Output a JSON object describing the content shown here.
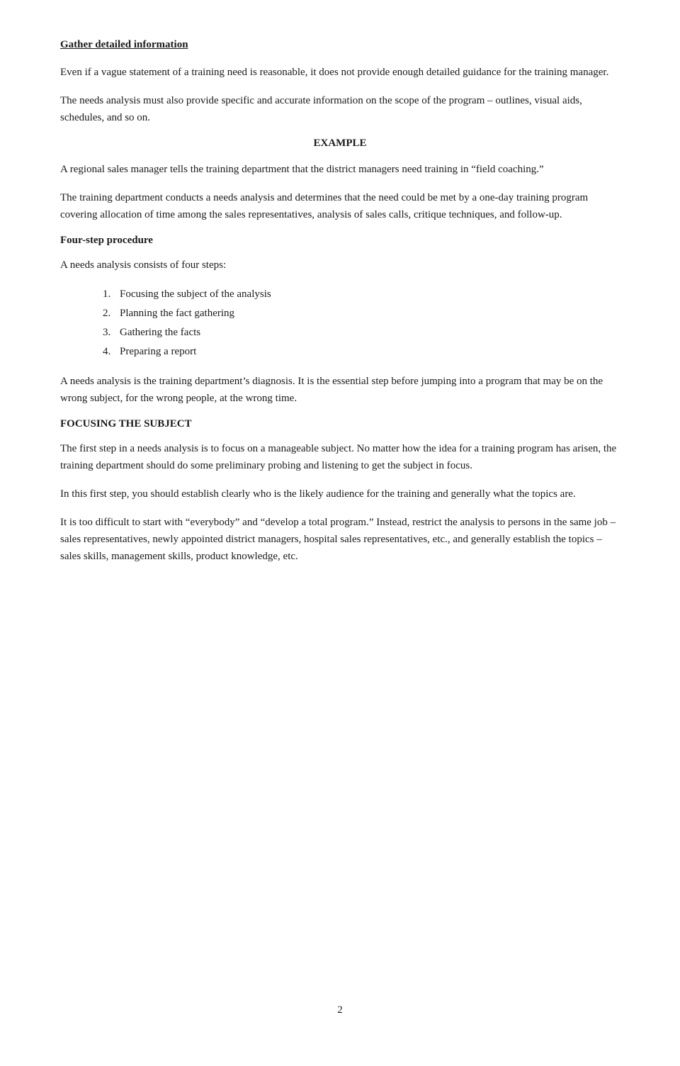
{
  "page": {
    "page_number": "2",
    "heading": "Gather detailed information",
    "paragraphs": {
      "intro1": "Even if a vague statement of a training need is reasonable, it does not provide enough detailed guidance for the training manager.",
      "intro2": "The needs analysis must also provide specific and accurate information on the scope of the program – outlines, visual aids, schedules, and so on.",
      "example_heading": "EXAMPLE",
      "example_p1": "A regional sales manager tells the training department that the district managers need training in “field coaching.”",
      "example_p2": "The training department conducts a needs analysis and determines that the need could be met by a one-day training program covering allocation of time among the sales representatives, analysis of sales calls, critique techniques, and follow-up.",
      "four_step_heading": "Four-step procedure",
      "four_step_intro": "A needs analysis consists of four steps:",
      "list_items": [
        {
          "num": "1.",
          "text": "Focusing the subject of the analysis"
        },
        {
          "num": "2.",
          "text": "Planning the fact gathering"
        },
        {
          "num": "3.",
          "text": "Gathering the facts"
        },
        {
          "num": "4.",
          "text": "Preparing a report"
        }
      ],
      "diagnosis_p1": "A needs analysis is the training department’s diagnosis.  It is the essential step before jumping into a program that may be on the wrong subject, for the wrong people, at the wrong time.",
      "focusing_heading": "FOCUSING THE SUBJECT",
      "focusing_p1": "The first step in a needs analysis is to focus on a manageable subject.  No matter how the idea for a training program has arisen, the training department should do some preliminary probing and listening to get the subject in focus.",
      "focusing_p2": "In this first step, you should establish clearly who is the likely audience for the training and generally what the topics are.",
      "focusing_p3": "It is too difficult to start with “everybody” and “develop a total program.”  Instead, restrict the analysis to persons in the same job – sales representatives, newly appointed district managers, hospital sales representatives, etc., and generally establish the topics – sales skills, management skills, product knowledge, etc."
    }
  }
}
